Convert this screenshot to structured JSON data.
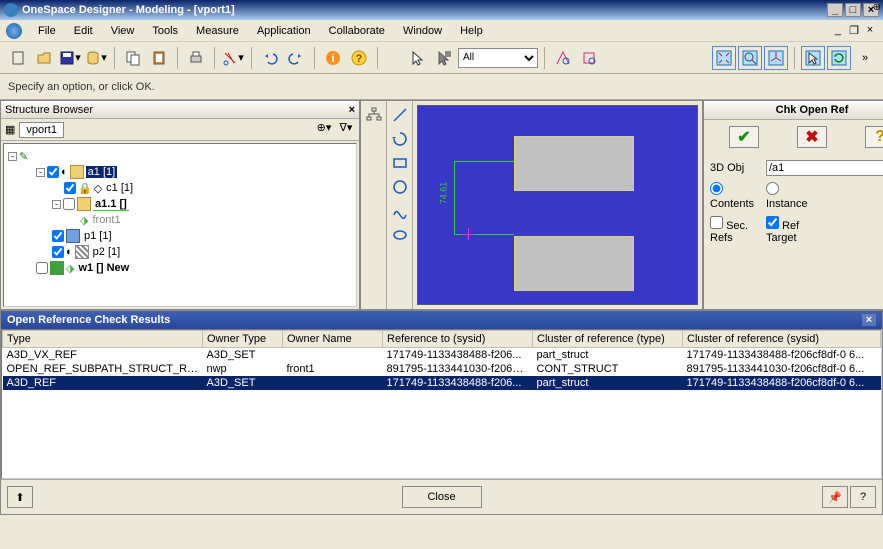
{
  "window": {
    "title": "OneSpace Designer - Modeling - [vport1]"
  },
  "menu": {
    "file": "File",
    "edit": "Edit",
    "view": "View",
    "tools": "Tools",
    "measure": "Measure",
    "application": "Application",
    "collaborate": "Collaborate",
    "window": "Window",
    "help": "Help"
  },
  "toolbar_combo": {
    "value": "All"
  },
  "prompt": {
    "text": "Specify an option, or click OK."
  },
  "structure": {
    "title": "Structure Browser",
    "vport": "vport1",
    "nodes": {
      "a1": "a1 [1]",
      "c1": "c1 [1]",
      "a11": "a1.1 []",
      "front1": "front1",
      "p1": "p1 [1]",
      "p2": "p2 [1]",
      "w1": "w1 [] New"
    }
  },
  "viewport": {
    "dim_label": "74.61"
  },
  "check_panel": {
    "title": "Chk Open Ref",
    "field_label": "3D Obj",
    "field_value": "/a1",
    "radio_contents": "Contents",
    "radio_instance": "Instance",
    "chk_secrefs": "Sec. Refs",
    "chk_reftarget": "Ref Target"
  },
  "results": {
    "title": "Open Reference Check Results",
    "cols": {
      "type": "Type",
      "owner_type": "Owner Type",
      "owner_name": "Owner Name",
      "ref_to": "Reference to (sysid)",
      "cluster_type": "Cluster of reference (type)",
      "cluster_sysid": "Cluster of reference (sysid)"
    },
    "rows": [
      {
        "type": "A3D_VX_REF",
        "owner_type": "A3D_SET",
        "owner_name": "",
        "ref_to": "171749-1133438488-f206...",
        "cluster_type": "part_struct",
        "cluster_sysid": "171749-1133438488-f206cf8df-0 6..."
      },
      {
        "type": "OPEN_REF_SUBPATH_STRUCT_REL",
        "owner_type": "nwp",
        "owner_name": "front1",
        "ref_to": "891795-1133441030-f206cf8df-0...",
        "cluster_type": "CONT_STRUCT",
        "cluster_sysid": "891795-1133441030-f206cf8df-0 6..."
      },
      {
        "type": "A3D_REF",
        "owner_type": "A3D_SET",
        "owner_name": "",
        "ref_to": "171749-1133438488-f206...",
        "cluster_type": "part_struct",
        "cluster_sysid": "171749-1133438488-f206cf8df-0 6..."
      }
    ],
    "close_btn": "Close"
  }
}
